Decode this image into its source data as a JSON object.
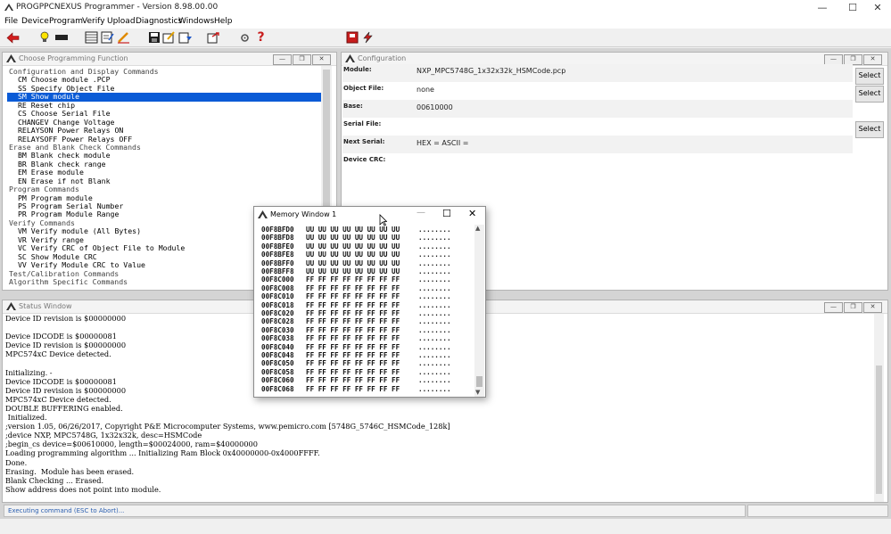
{
  "app": {
    "title": "PROGPPCNEXUS Programmer - Version 8.98.00.00",
    "win_min": "—",
    "win_max": "☐",
    "win_close": "✕"
  },
  "menu": [
    "File",
    "Device",
    "Program",
    "Verify",
    "Upload",
    "Diagnostics",
    "Windows",
    "Help"
  ],
  "toolbar_icons": [
    "exit-icon",
    "bulb-icon",
    "chip-icon",
    "memory-grid-icon",
    "edit-doc-icon",
    "config-icon",
    "pencil-icon",
    "save-icon",
    "load-icon",
    "write-icon",
    "export-icon",
    "settings-icon",
    "help-icon",
    "stop-save-icon",
    "flash-icon"
  ],
  "choose": {
    "title": "Choose Programming Function",
    "items": [
      {
        "text": "Configuration and Display Commands",
        "kind": "cat"
      },
      {
        "text": "CM Choose module .PCP",
        "kind": "cmd"
      },
      {
        "text": "SS Specify Object File",
        "kind": "cmd"
      },
      {
        "text": "SM Show module",
        "kind": "cmd",
        "selected": true
      },
      {
        "text": "RE Reset chip",
        "kind": "cmd"
      },
      {
        "text": "CS Choose Serial File",
        "kind": "cmd"
      },
      {
        "text": "CHANGEV Change Voltage",
        "kind": "cmd"
      },
      {
        "text": "RELAYSON Power Relays ON",
        "kind": "cmd"
      },
      {
        "text": "RELAYSOFF Power Relays OFF",
        "kind": "cmd"
      },
      {
        "text": "Erase and Blank Check Commands",
        "kind": "cat"
      },
      {
        "text": "BM Blank check module",
        "kind": "cmd"
      },
      {
        "text": "BR Blank check range",
        "kind": "cmd"
      },
      {
        "text": "EM Erase module",
        "kind": "cmd"
      },
      {
        "text": "EN Erase if not Blank",
        "kind": "cmd"
      },
      {
        "text": "Program Commands",
        "kind": "cat"
      },
      {
        "text": "PM Program module",
        "kind": "cmd"
      },
      {
        "text": "PS Program Serial Number",
        "kind": "cmd"
      },
      {
        "text": "PR Program Module Range",
        "kind": "cmd"
      },
      {
        "text": "Verify Commands",
        "kind": "cat"
      },
      {
        "text": "VM Verify module (All Bytes)",
        "kind": "cmd"
      },
      {
        "text": "VR Verify range",
        "kind": "cmd"
      },
      {
        "text": "VC Verify CRC of Object File to Module",
        "kind": "cmd"
      },
      {
        "text": "SC Show Module CRC",
        "kind": "cmd"
      },
      {
        "text": "VV Verify Module CRC to Value",
        "kind": "cmd"
      },
      {
        "text": "Test/Calibration Commands",
        "kind": "cat"
      },
      {
        "text": "Algorithm Specific Commands",
        "kind": "cat"
      }
    ]
  },
  "configuration": {
    "title": "Configuration",
    "module_label": "Module:",
    "module_value": "NXP_MPC5748G_1x32x32k_HSMCode.pcp",
    "object_label": "Object File:",
    "object_value": "none",
    "base_label": "Base:",
    "base_value": "00610000",
    "serial_label": "Serial File:",
    "serial_value": "",
    "next_serial_label": "Next Serial:",
    "next_serial_value": "HEX =  ASCII =",
    "crc_label": "Device CRC:",
    "crc_value": "",
    "select_label": "Select"
  },
  "status": {
    "title": "Status Window",
    "lines": [
      "Device ID revision is $00000000",
      "",
      "Device IDCODE is $00000081",
      "Device ID revision is $00000000",
      "MPC574xC Device detected.",
      "",
      "Initializing. -",
      "Device IDCODE is $00000081",
      "Device ID revision is $00000000",
      "MPC574xC Device detected.",
      "DOUBLE BUFFERING enabled.",
      " Initialized.",
      ";version 1.05, 06/26/2017, Copyright P&E Microcomputer Systems, www.pemicro.com [5748G_5746C_HSMCode_128k]",
      ";device NXP, MPC5748G, 1x32x32k, desc=HSMCode",
      ";begin_cs device=$00610000, length=$00024000, ram=$40000000",
      "Loading programming algorithm ... Initializing Ram Block 0x40000000-0x4000FFFF.",
      "Done.",
      "Erasing.  Module has been erased.",
      "Blank Checking ... Erased.",
      "Show address does not point into module."
    ],
    "bar_text": "Executing command (ESC to Abort)..."
  },
  "memory": {
    "title": "Memory Window 1",
    "rows": [
      {
        "addr": "00F8BFD0",
        "bytes": "UU UU UU UU UU UU UU UU",
        "ascii": "........"
      },
      {
        "addr": "00F8BFD8",
        "bytes": "UU UU UU UU UU UU UU UU",
        "ascii": "........"
      },
      {
        "addr": "00F8BFE0",
        "bytes": "UU UU UU UU UU UU UU UU",
        "ascii": "........"
      },
      {
        "addr": "00F8BFE8",
        "bytes": "UU UU UU UU UU UU UU UU",
        "ascii": "........"
      },
      {
        "addr": "00F8BFF0",
        "bytes": "UU UU UU UU UU UU UU UU",
        "ascii": "........"
      },
      {
        "addr": "00F8BFF8",
        "bytes": "UU UU UU UU UU UU UU UU",
        "ascii": "........"
      },
      {
        "addr": "00F8C000",
        "bytes": "FF FF FF FF FF FF FF FF",
        "ascii": "........"
      },
      {
        "addr": "00F8C008",
        "bytes": "FF FF FF FF FF FF FF FF",
        "ascii": "........"
      },
      {
        "addr": "00F8C010",
        "bytes": "FF FF FF FF FF FF FF FF",
        "ascii": "........"
      },
      {
        "addr": "00F8C018",
        "bytes": "FF FF FF FF FF FF FF FF",
        "ascii": "........"
      },
      {
        "addr": "00F8C020",
        "bytes": "FF FF FF FF FF FF FF FF",
        "ascii": "........"
      },
      {
        "addr": "00F8C028",
        "bytes": "FF FF FF FF FF FF FF FF",
        "ascii": "........"
      },
      {
        "addr": "00F8C030",
        "bytes": "FF FF FF FF FF FF FF FF",
        "ascii": "........"
      },
      {
        "addr": "00F8C038",
        "bytes": "FF FF FF FF FF FF FF FF",
        "ascii": "........"
      },
      {
        "addr": "00F8C040",
        "bytes": "FF FF FF FF FF FF FF FF",
        "ascii": "........"
      },
      {
        "addr": "00F8C048",
        "bytes": "FF FF FF FF FF FF FF FF",
        "ascii": "........"
      },
      {
        "addr": "00F8C050",
        "bytes": "FF FF FF FF FF FF FF FF",
        "ascii": "........"
      },
      {
        "addr": "00F8C058",
        "bytes": "FF FF FF FF FF FF FF FF",
        "ascii": "........"
      },
      {
        "addr": "00F8C060",
        "bytes": "FF FF FF FF FF FF FF FF",
        "ascii": "........"
      },
      {
        "addr": "00F8C068",
        "bytes": "FF FF FF FF FF FF FF FF",
        "ascii": "........"
      }
    ]
  },
  "colors": {
    "selection": "#0a5bd6",
    "accent_red": "#c8201a"
  }
}
